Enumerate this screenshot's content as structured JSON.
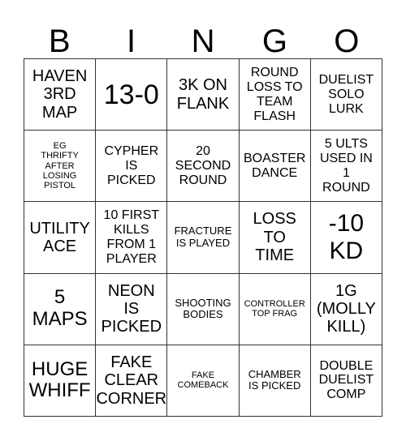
{
  "header": {
    "letters": [
      "B",
      "I",
      "N",
      "G",
      "O"
    ]
  },
  "cells": [
    {
      "text": "HAVEN\n3RD\nMAP",
      "size": "lg"
    },
    {
      "text": "13-0",
      "size": "huge"
    },
    {
      "text": "3K ON\nFLANK",
      "size": "lg"
    },
    {
      "text": "ROUND\nLOSS TO\nTEAM\nFLASH",
      "size": "md"
    },
    {
      "text": "DUELIST\nSOLO\nLURK",
      "size": "md"
    },
    {
      "text": "EG\nTHRIFTY\nAFTER\nLOSING\nPISTOL",
      "size": "xs"
    },
    {
      "text": "CYPHER\nIS\nPICKED",
      "size": "md"
    },
    {
      "text": "20\nSECOND\nROUND",
      "size": "md"
    },
    {
      "text": "BOASTER\nDANCE",
      "size": "md"
    },
    {
      "text": "5 ULTS\nUSED IN\n1\nROUND",
      "size": "md"
    },
    {
      "text": "UTILITY\nACE",
      "size": "lg"
    },
    {
      "text": "10 FIRST\nKILLS\nFROM 1\nPLAYER",
      "size": "md"
    },
    {
      "text": "FRACTURE\nIS PLAYED",
      "size": "sm"
    },
    {
      "text": "LOSS\nTO\nTIME",
      "size": "lg"
    },
    {
      "text": "-10\nKD",
      "size": "xxl"
    },
    {
      "text": "5\nMAPS",
      "size": "xl"
    },
    {
      "text": "NEON\nIS\nPICKED",
      "size": "lg"
    },
    {
      "text": "SHOOTING\nBODIES",
      "size": "sm"
    },
    {
      "text": "CONTROLLER\nTOP FRAG",
      "size": "xs"
    },
    {
      "text": "1G\n(MOLLY\nKILL)",
      "size": "lg"
    },
    {
      "text": "HUGE\nWHIFF",
      "size": "xl"
    },
    {
      "text": "FAKE\nCLEAR\nCORNER",
      "size": "lg"
    },
    {
      "text": "FAKE\nCOMEBACK",
      "size": "xs"
    },
    {
      "text": "CHAMBER\nIS PICKED",
      "size": "sm"
    },
    {
      "text": "DOUBLE\nDUELIST\nCOMP",
      "size": "md"
    }
  ]
}
